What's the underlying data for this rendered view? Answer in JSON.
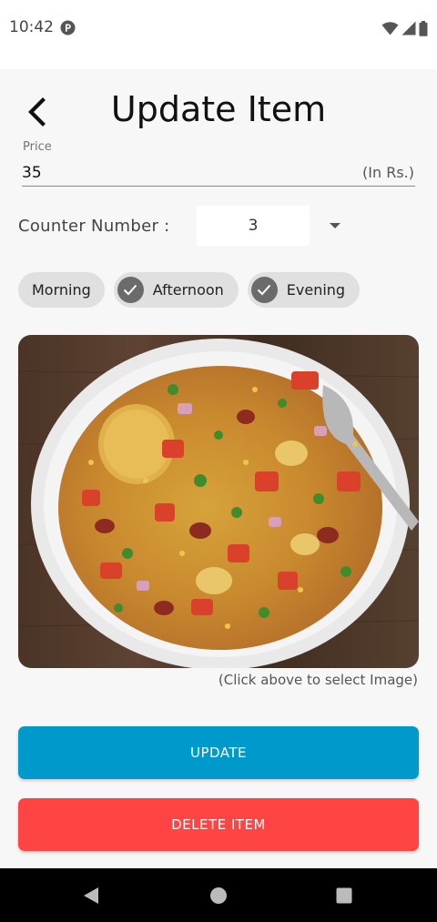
{
  "status_bar": {
    "time": "10:42",
    "icons": [
      "wifi-icon",
      "signal-icon",
      "battery-icon"
    ]
  },
  "header": {
    "title": "Update Item",
    "back_icon": "back-arrow-icon"
  },
  "price": {
    "label": "Price",
    "value": "35",
    "suffix": "(In Rs.)"
  },
  "counter": {
    "label": "Counter Number :",
    "selected": "3"
  },
  "chips": [
    {
      "label": "Morning",
      "checked": false
    },
    {
      "label": "Afternoon",
      "checked": true
    },
    {
      "label": "Evening",
      "checked": true
    }
  ],
  "image": {
    "hint": "(Click above to select Image)"
  },
  "buttons": {
    "update_label": "UPDATE",
    "delete_label": "DELETE ITEM"
  },
  "colors": {
    "update": "#0099cc",
    "delete": "#ff4444",
    "chip_bg": "#e0e0e0",
    "chip_check": "#6b6b6b"
  }
}
